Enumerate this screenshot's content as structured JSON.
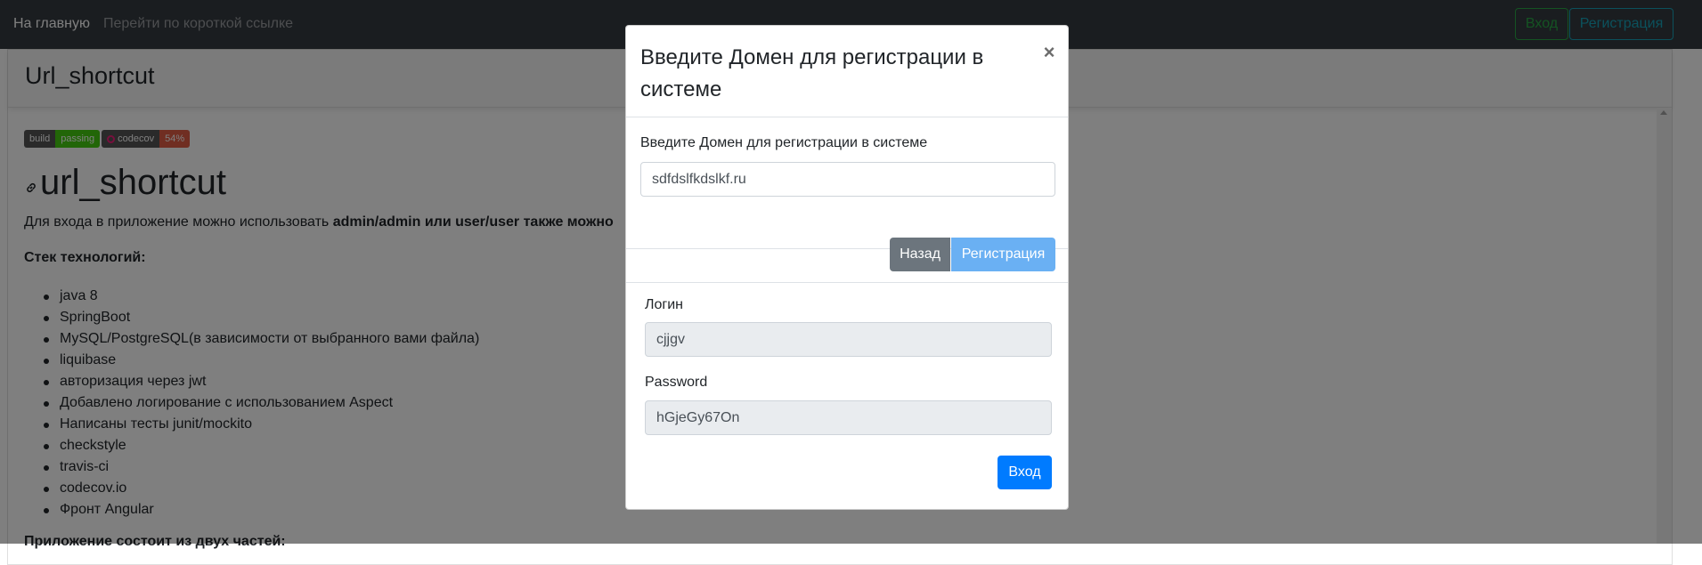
{
  "navbar": {
    "brand": "На главную",
    "link": "Перейти по короткой ссылке",
    "login_button": "Вход",
    "register_button": "Регистрация"
  },
  "card": {
    "title": "Url_shortcut"
  },
  "badges": {
    "build_label": "build",
    "build_status": "passing",
    "codecov_label": "codecov",
    "codecov_value": "54%"
  },
  "content": {
    "heading": "url_shortcut",
    "intro_prefix": "Для входа в приложение можно использовать ",
    "intro_bold": "admin/admin или user/user также можно",
    "stack_title": "Стек технологий:",
    "stack_items": [
      "java 8",
      "SpringBoot",
      "MySQL/PostgreSQL(в зависимости от выбранного вами файла)",
      "liquibase",
      "авторизация через jwt",
      "Добавлено логирование с использованием Aspect",
      "Написаны тесты junit/mockito",
      "checkstyle",
      "travis-ci",
      "codecov.io",
      "Фронт Angular"
    ],
    "bottom_text": "Приложение состоит из двух частей:"
  },
  "modal": {
    "title": "Введите Домен для регистрации в системе",
    "close_symbol": "×",
    "domain_label": "Введите Домен для регистрации в системе",
    "domain_value": "sdfdslfkdslkf.ru",
    "back_button": "Назад",
    "register_button": "Регистрация",
    "login_label": "Логин",
    "login_value": "cjjgv",
    "password_label": "Password",
    "password_value": "hGjeGy67On",
    "enter_button": "Вход"
  },
  "colors": {
    "navbar_bg": "#343a40",
    "login_outline": "#28a745",
    "register_outline": "#17a2b8",
    "primary": "#007bff",
    "secondary": "#6c757d"
  }
}
